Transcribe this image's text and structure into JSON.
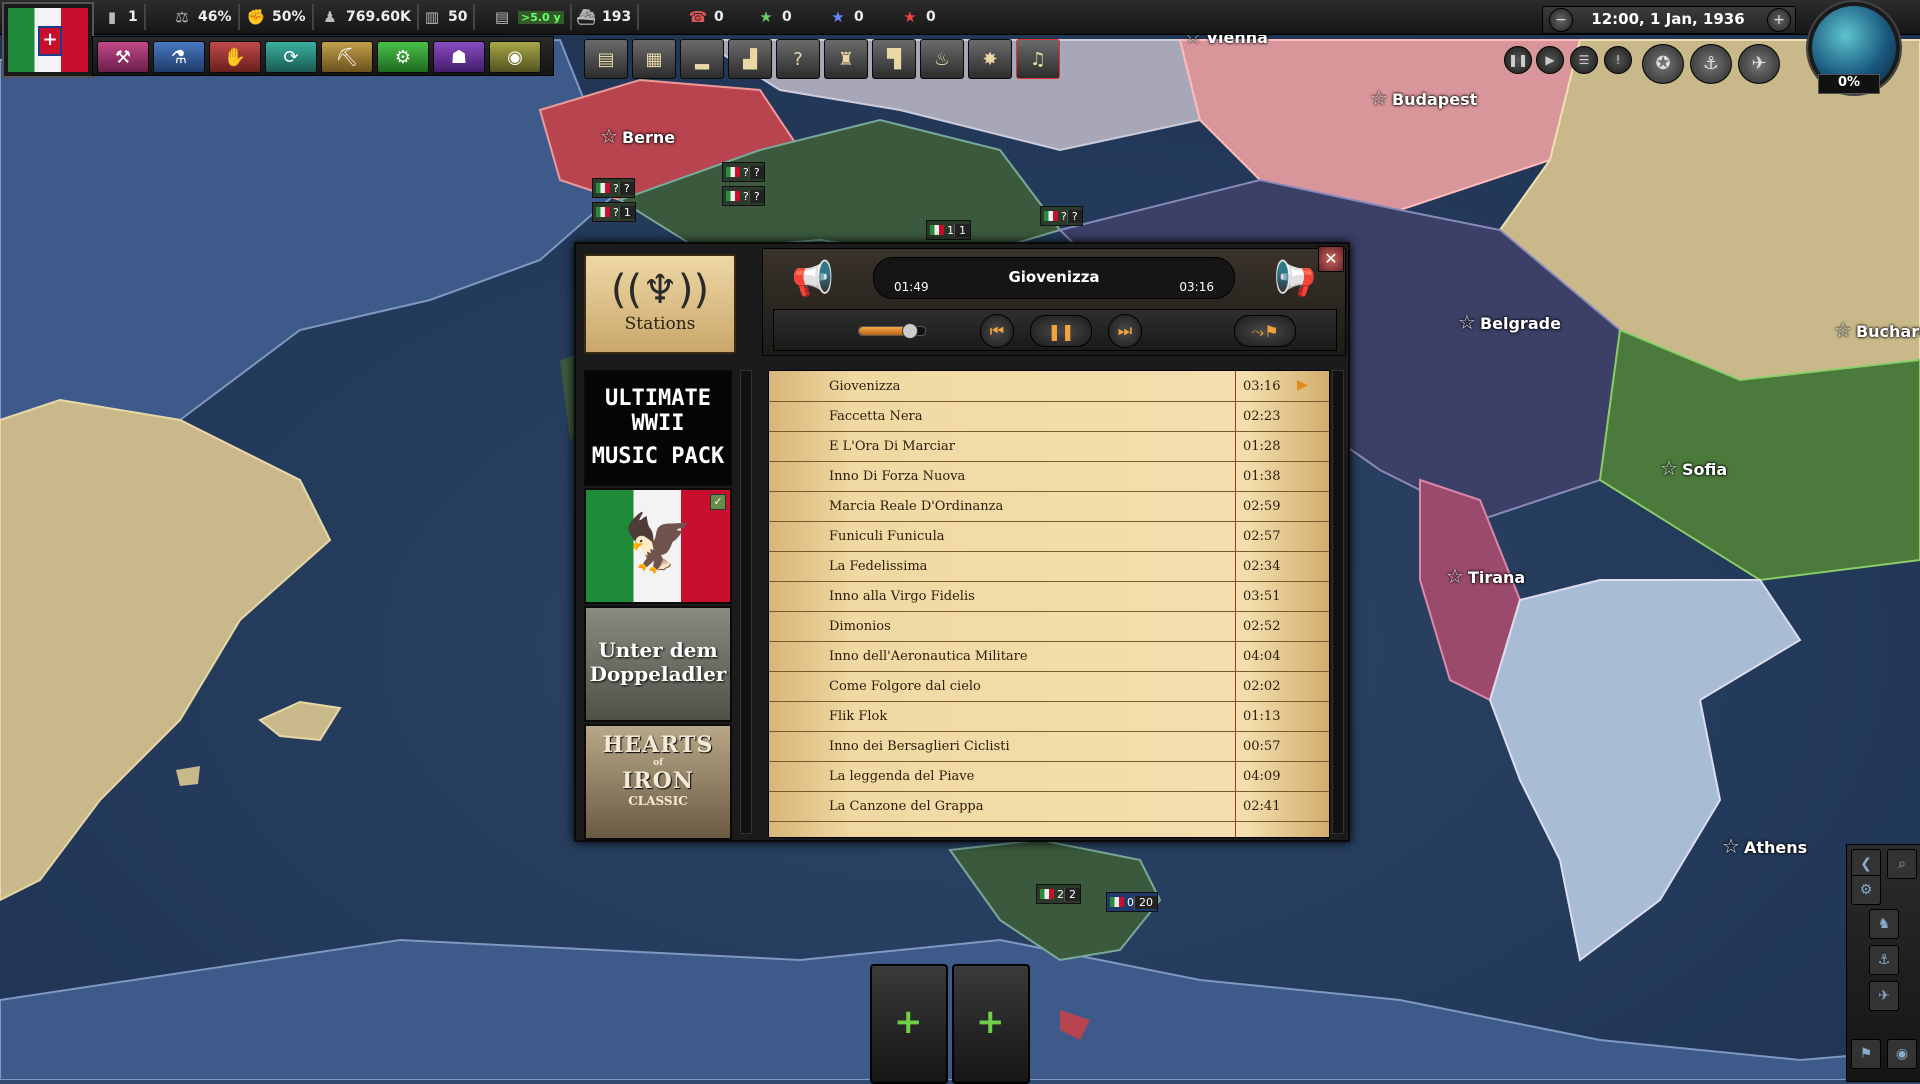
{
  "top_bar": {
    "political_power": "1",
    "stability": "46%",
    "war_support": "50%",
    "manpower": "769.60K",
    "factories": "50",
    "convoys_badge": ">5.0 y",
    "convoys": "193",
    "counter_a": "0",
    "counter_b": "0",
    "counter_c": "0",
    "counter_d": "0"
  },
  "clock": {
    "datetime": "12:00, 1 Jan, 1936",
    "minus": "−",
    "plus": "+"
  },
  "world_tension": "0%",
  "map": {
    "cities": [
      {
        "name": "Vienna"
      },
      {
        "name": "Budapest"
      },
      {
        "name": "Berne"
      },
      {
        "name": "Belgrade"
      },
      {
        "name": "Buchare"
      },
      {
        "name": "Sofia"
      },
      {
        "name": "Tirana"
      },
      {
        "name": "Athens"
      }
    ],
    "units": [
      {
        "label": "?",
        "count": "?"
      },
      {
        "label": "?",
        "count": "1"
      },
      {
        "label": "?",
        "count": "?"
      },
      {
        "label": "?",
        "count": "?"
      },
      {
        "label": "1",
        "count": "1"
      },
      {
        "label": "?",
        "count": "?"
      },
      {
        "label": "2",
        "count": "2"
      },
      {
        "label": "0",
        "count": "20"
      }
    ]
  },
  "radio": {
    "stations_label": "Stations",
    "track_title": "Giovenizza",
    "elapsed": "01:49",
    "total": "03:16",
    "volume": 0.75,
    "close": "✕",
    "packs": [
      {
        "line1": "ULTIMATE WWII",
        "line2": "MUSIC PACK"
      },
      {
        "name": "Italian"
      },
      {
        "line1": "Unter dem",
        "line2": "Doppeladler"
      },
      {
        "line1": "HEARTS",
        "line2": "of",
        "line3": "IRON",
        "line4": "CLASSIC"
      }
    ],
    "playlist": [
      {
        "name": "Giovenizza",
        "duration": "03:16"
      },
      {
        "name": "Faccetta Nera",
        "duration": "02:23"
      },
      {
        "name": "E L'Ora Di Marciar",
        "duration": "01:28"
      },
      {
        "name": "Inno Di Forza Nuova",
        "duration": "01:38"
      },
      {
        "name": "Marcia Reale D'Ordinanza",
        "duration": "02:59"
      },
      {
        "name": "Funiculi Funicula",
        "duration": "02:57"
      },
      {
        "name": "La Fedelissima",
        "duration": "02:34"
      },
      {
        "name": "Inno alla Virgo Fidelis",
        "duration": "03:51"
      },
      {
        "name": "Dimonios",
        "duration": "02:52"
      },
      {
        "name": "Inno dell'Aeronautica Militare",
        "duration": "04:04"
      },
      {
        "name": "Come Folgore dal cielo",
        "duration": "02:02"
      },
      {
        "name": "Flik Flok",
        "duration": "01:13"
      },
      {
        "name": "Inno dei Bersaglieri Ciclisti",
        "duration": "00:57"
      },
      {
        "name": "La leggenda del Piave",
        "duration": "04:09"
      },
      {
        "name": "La Canzone del Grappa",
        "duration": "02:41"
      }
    ]
  },
  "colors": {
    "accent": "#f2a33a",
    "sea": "#2f4a6e",
    "paper": "#f0d9a3"
  }
}
